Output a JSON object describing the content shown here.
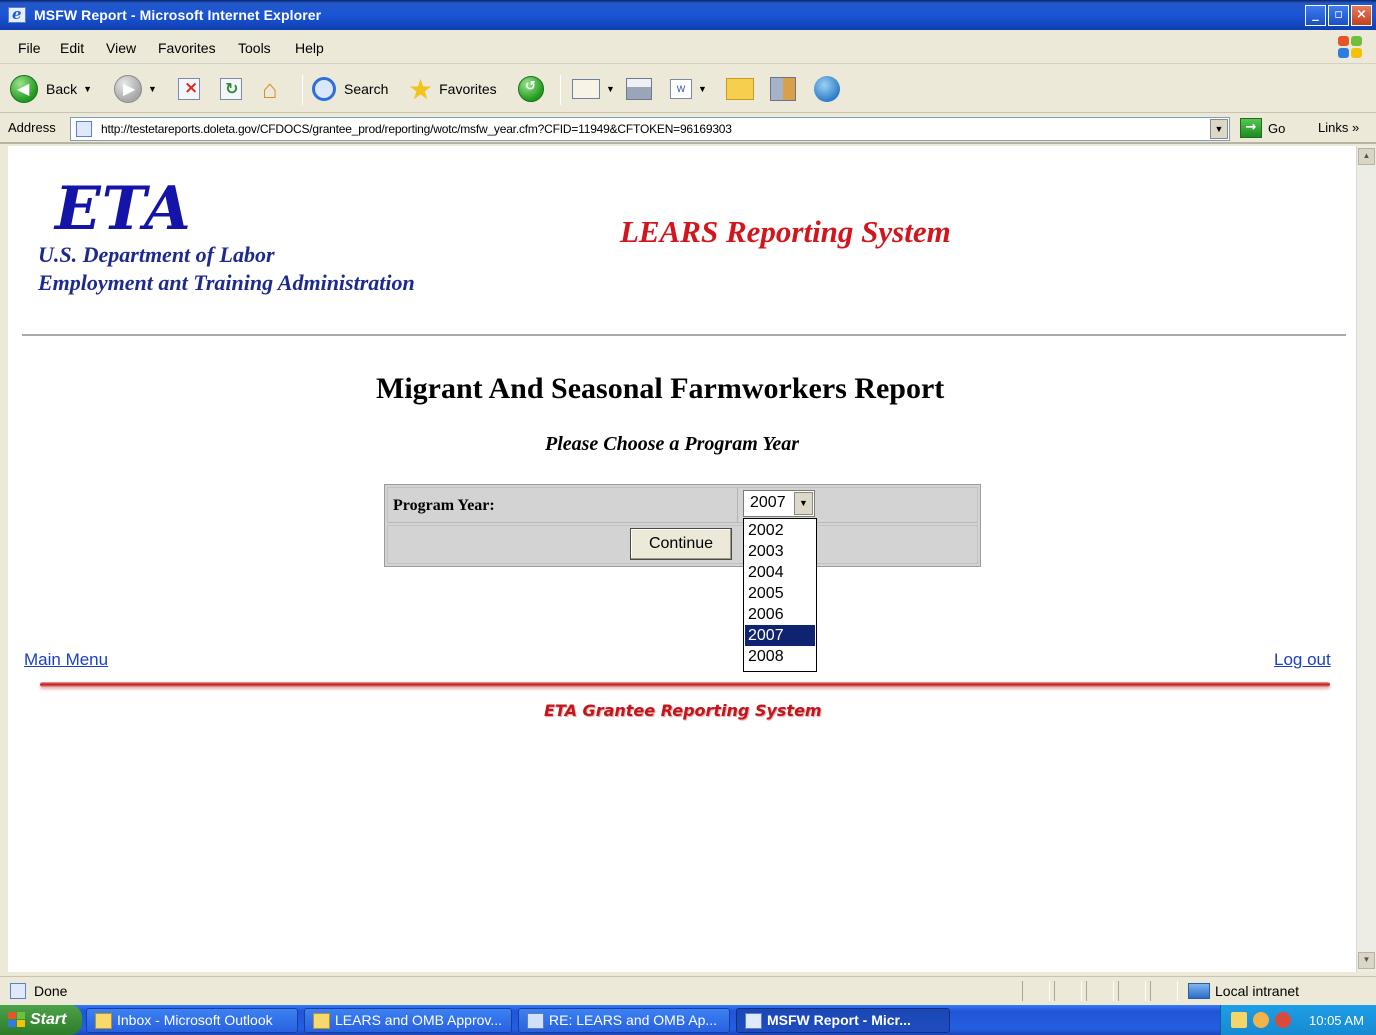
{
  "window": {
    "title": "MSFW Report - Microsoft Internet Explorer",
    "controls": {
      "minimize": "_",
      "maximize": "▫",
      "close": "×"
    }
  },
  "menu": [
    "File",
    "Edit",
    "View",
    "Favorites",
    "Tools",
    "Help"
  ],
  "toolbar": {
    "back_label": "Back",
    "search_label": "Search",
    "favorites_label": "Favorites"
  },
  "address": {
    "label": "Address",
    "url": "http://testetareports.doleta.gov/CFDOCS/grantee_prod/reporting/wotc/msfw_year.cfm?CFID=11949&CFTOKEN=96169303",
    "go_label": "Go",
    "links_label": "Links"
  },
  "page": {
    "logo": "ETA",
    "dept_line1": "U.S. Department of Labor",
    "dept_line2": "Employment ant Training Administration",
    "system_title": "LEARS Reporting System",
    "report_title": "Migrant And Seasonal Farmworkers Report",
    "instruction": "Please Choose a Program Year",
    "program_year_label": "Program Year:",
    "program_year_value": "2007",
    "program_year_options": [
      "2002",
      "2003",
      "2004",
      "2005",
      "2006",
      "2007",
      "2008"
    ],
    "program_year_selected": "2007",
    "continue_label": "Continue",
    "main_menu_link": "Main Menu",
    "logout_link": "Log out",
    "footer": "ETA Grantee Reporting System"
  },
  "status": {
    "text": "Done",
    "zone": "Local intranet"
  },
  "taskbar": {
    "start_label": "Start",
    "tasks": [
      "Inbox - Microsoft Outlook",
      "LEARS and OMB Approv...",
      "RE: LEARS and OMB Ap...",
      "MSFW Report - Micr..."
    ],
    "clock": "10:05 AM"
  },
  "colors": {
    "title_bar": "#245edb",
    "logo_blue": "#1414a8",
    "system_red": "#d2161e",
    "link_blue": "#1a3fc4",
    "selection": "#0f2471"
  }
}
